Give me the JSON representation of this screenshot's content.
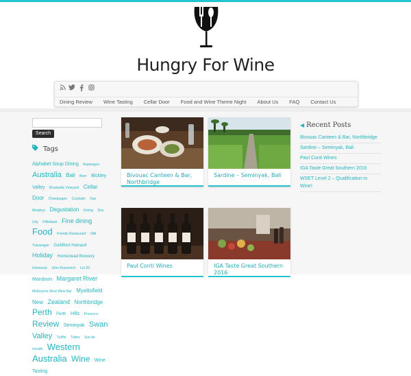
{
  "site": {
    "title": "Hungry For Wine"
  },
  "social": [
    "rss-icon",
    "twitter-icon",
    "facebook-icon",
    "instagram-icon"
  ],
  "nav": [
    "Dining Review",
    "Wine Tasting",
    "Cellar Door",
    "Food and Wine Theme Night",
    "About Us",
    "FAQ",
    "Contact Us"
  ],
  "search": {
    "button": "Search",
    "placeholder": ""
  },
  "tags": {
    "heading": "Tags",
    "items": [
      {
        "t": "Alphabet Soup Dining",
        "s": 7
      },
      {
        "t": "Asparagus",
        "s": 5
      },
      {
        "t": "Australia",
        "s": 11
      },
      {
        "t": "Bali",
        "s": 8
      },
      {
        "t": "Beer",
        "s": 5
      },
      {
        "t": "Bickley Valley",
        "s": 7
      },
      {
        "t": "Brookside Vineyard",
        "s": 5
      },
      {
        "t": "Cellar Door",
        "s": 8
      },
      {
        "t": "Champagne",
        "s": 5
      },
      {
        "t": "Cocktails",
        "s": 5
      },
      {
        "t": "Dan Murphys",
        "s": 5
      },
      {
        "t": "Degustation",
        "s": 8
      },
      {
        "t": "Dining",
        "s": 5
      },
      {
        "t": "Dos Urly",
        "s": 5
      },
      {
        "t": "Fiffeldack",
        "s": 5
      },
      {
        "t": "Fine dining",
        "s": 9
      },
      {
        "t": "Food",
        "s": 13
      },
      {
        "t": "Friends Restaurant",
        "s": 5
      },
      {
        "t": "Gilli Trawangan",
        "s": 5
      },
      {
        "t": "Guildford Hainault",
        "s": 6
      },
      {
        "t": "Holiday",
        "s": 9
      },
      {
        "t": "Homestead Brewery",
        "s": 6
      },
      {
        "t": "Indonesia",
        "s": 5
      },
      {
        "t": "John Rossovich",
        "s": 5
      },
      {
        "t": "Lot 20",
        "s": 5
      },
      {
        "t": "Mandoon",
        "s": 7
      },
      {
        "t": "Margaret River",
        "s": 9
      },
      {
        "t": "Melbourne Must Wine Bar",
        "s": 5
      },
      {
        "t": "Myattsfield",
        "s": 8
      },
      {
        "t": "New",
        "s": 8
      },
      {
        "t": "Zealand",
        "s": 9
      },
      {
        "t": "Northbridge",
        "s": 8
      },
      {
        "t": "Perth",
        "s": 12
      },
      {
        "t": "Perth",
        "s": 6
      },
      {
        "t": "Hills",
        "s": 7
      },
      {
        "t": "Prosecco",
        "s": 5
      },
      {
        "t": "Review",
        "s": 12
      },
      {
        "t": "Seminyak",
        "s": 7
      },
      {
        "t": "Swan Valley",
        "s": 11
      },
      {
        "t": "Truffle",
        "s": 5
      },
      {
        "t": "Tuttos",
        "s": 5
      },
      {
        "t": "Vue de",
        "s": 5
      },
      {
        "t": "monde",
        "s": 5
      },
      {
        "t": "Western",
        "s": 13
      },
      {
        "t": "Australia",
        "s": 13
      },
      {
        "t": "Wine",
        "s": 12
      },
      {
        "t": "Wine",
        "s": 7
      },
      {
        "t": "Tasting",
        "s": 7
      }
    ]
  },
  "posts": [
    {
      "title": "Bivouac Canteen & Bar, Northbridge",
      "scene": "dining"
    },
    {
      "title": "Sardine – Seminyak, Bali",
      "scene": "ricefield"
    },
    {
      "title": "Paul Conti Wines",
      "scene": "bottles"
    },
    {
      "title": "IGA Taste Great Southern 2016",
      "scene": "market"
    }
  ],
  "recent": {
    "heading": "Recent Posts",
    "items": [
      "Bivouac Canteen & Bar, Northbridge",
      "Sardine – Seminyak, Bali",
      "Paul Conti Wines",
      "IGA Taste Great Southern 2016",
      "WSET Level 2 – Qualification in Wine!"
    ]
  },
  "colors": {
    "accent": "#23c4d0",
    "link": "#23b3c0"
  }
}
